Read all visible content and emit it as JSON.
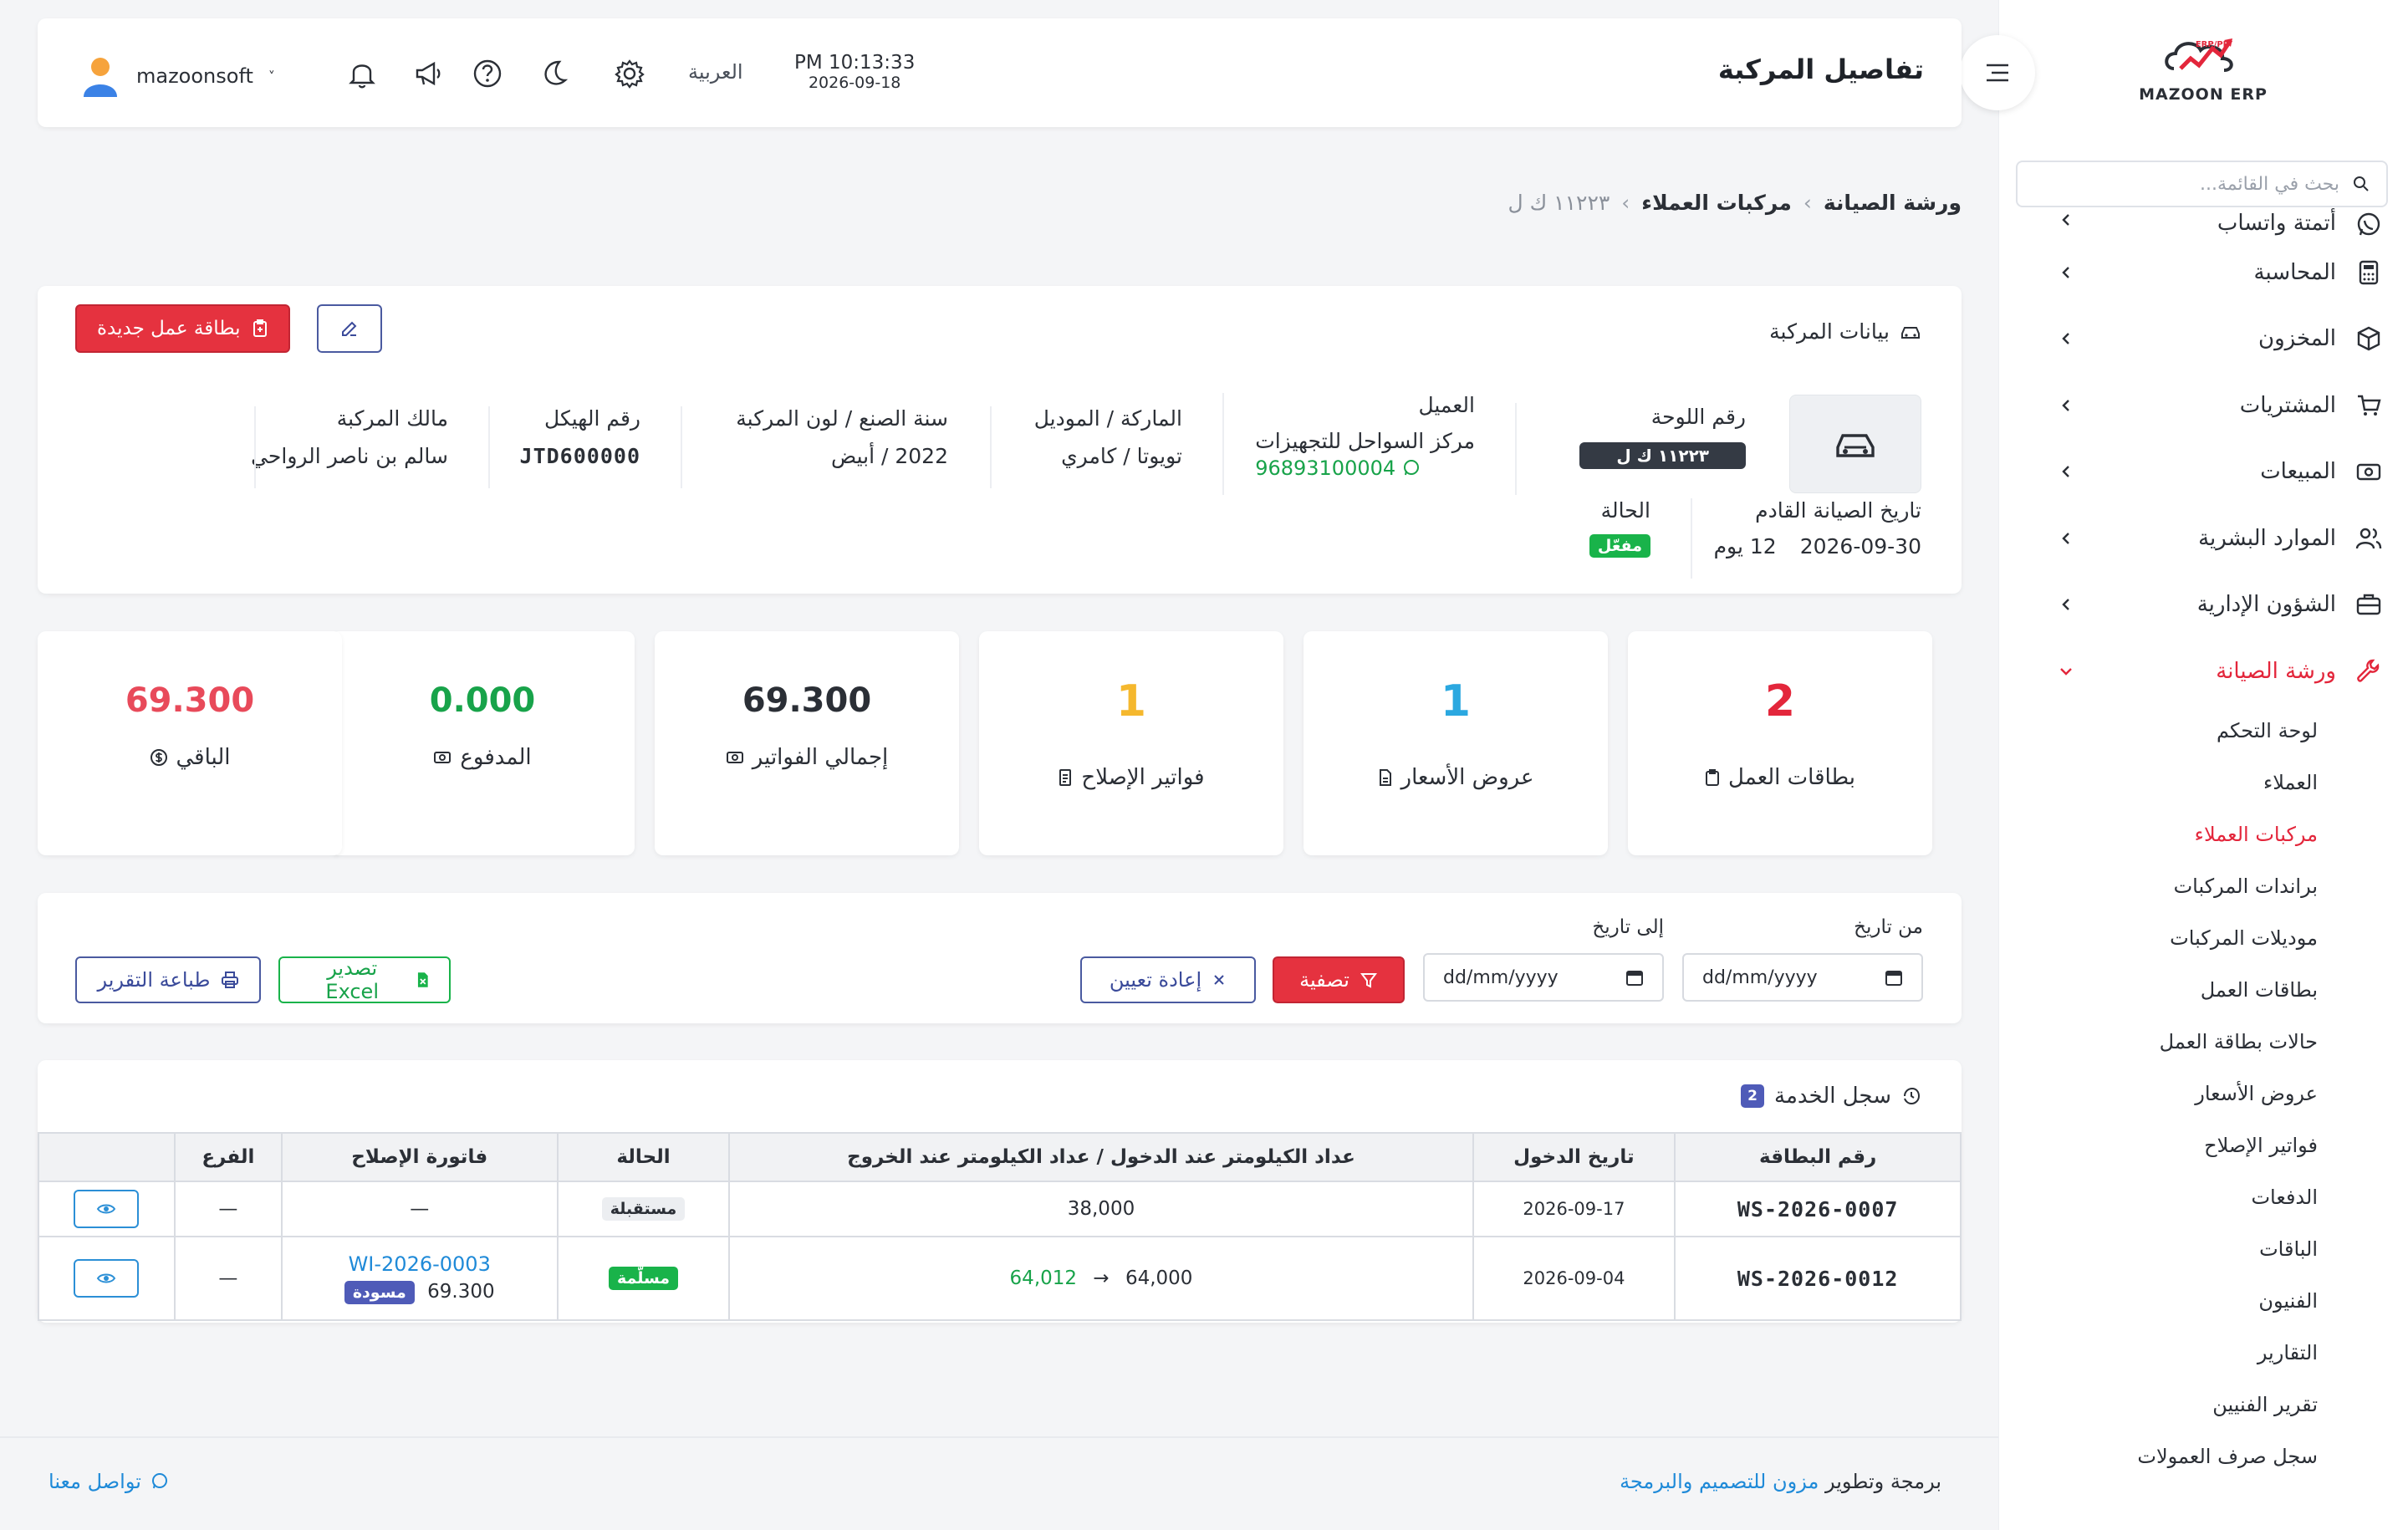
{
  "brand": {
    "name": "MAZOON ERP",
    "tagline": "ERP/PP"
  },
  "sidebar": {
    "search_placeholder": "بحث في القائمة...",
    "items": [
      {
        "label": "أتمتة واتساب",
        "icon": "whatsapp-icon"
      },
      {
        "label": "المحاسبة",
        "icon": "calculator-icon"
      },
      {
        "label": "المخزون",
        "icon": "box-icon"
      },
      {
        "label": "المشتريات",
        "icon": "cart-icon"
      },
      {
        "label": "المبيعات",
        "icon": "cash-icon"
      },
      {
        "label": "الموارد البشرية",
        "icon": "users-icon"
      },
      {
        "label": "الشؤون الإدارية",
        "icon": "briefcase-icon"
      },
      {
        "label": "ورشة الصيانة",
        "icon": "wrench-icon"
      }
    ],
    "subitems": [
      "لوحة التحكم",
      "العملاء",
      "مركبات العملاء",
      "براندات المركبات",
      "موديلات المركبات",
      "بطاقات العمل",
      "حالات بطاقة العمل",
      "عروض الأسعار",
      "فواتير الإصلاح",
      "الدفعات",
      "الباقات",
      "الفنيون",
      "التقارير",
      "تقرير الفنيين",
      "سجل صرف العمولات"
    ]
  },
  "header": {
    "title": "تفاصيل المركبة",
    "time": "PM 10:13:33",
    "date": "2026-09-18",
    "language": "العربية",
    "username": "mazoonsoft"
  },
  "breadcrumb": {
    "first": "ورشة الصيانة",
    "second": "مركبات العملاء",
    "current": "١١٢٢٣ ك ل"
  },
  "vehicle": {
    "section_title": "بيانات المركبة",
    "new_job_card": "بطاقة عمل جديدة",
    "plate_label": "رقم اللوحة",
    "plate_value": "١١٢٢٣ ك ل",
    "customer_label": "العميل",
    "customer_value": "مركز السواحل للتجهيزات",
    "customer_phone": "96893100004",
    "make_label": "الماركة / الموديل",
    "make_value": "تويوتا / كامري",
    "year_label": "سنة الصنع / لون المركبة",
    "year_value": "2022 / أبيض",
    "chassis_label": "رقم الهيكل",
    "chassis_value": "JTD600000",
    "owner_label": "مالك المركبة",
    "owner_value": "سالم بن ناصر الرواحي",
    "next_service_label": "تاريخ الصيانة القادم",
    "next_service_date": "2026-09-30",
    "next_service_days": "12 يوم",
    "status_label": "الحالة",
    "status_value": "مفعّل"
  },
  "stats": [
    {
      "label": "بطاقات العمل",
      "value": "2",
      "color": "#e3263b"
    },
    {
      "label": "عروض الأسعار",
      "value": "1",
      "color": "#2ba8e0"
    },
    {
      "label": "فواتير الإصلاح",
      "value": "1",
      "color": "#f5b82e"
    },
    {
      "label": "إجمالي الفواتير",
      "value": "69.300",
      "color": "#2b2f36"
    },
    {
      "label": "المدفوع",
      "value": "0.000",
      "color": "#18a34a"
    },
    {
      "label": "الباقي",
      "value": "69.300",
      "color": "#e84a5a"
    }
  ],
  "filter": {
    "from_label": "من تاريخ",
    "to_label": "إلى تاريخ",
    "date_placeholder": "dd/mm/yyyy",
    "filter_btn": "تصفية",
    "reset_btn": "إعادة تعيين",
    "excel_btn": "تصدير Excel",
    "print_btn": "طباعة التقرير"
  },
  "service_log": {
    "title": "سجل الخدمة",
    "count": "2",
    "columns": [
      "رقم البطاقة",
      "تاريخ الدخول",
      "عداد الكيلومتر عند الدخول / عداد الكيلومتر عند الخروج",
      "الحالة",
      "فاتورة الإصلاح",
      "الفرع",
      ""
    ],
    "rows": [
      {
        "card": "WS-2026-0007",
        "date": "2026-09-17",
        "km_in": "38,000",
        "km_out": "",
        "status": "مستقبلة",
        "invoice": "—",
        "amount": "",
        "invoice_status": "",
        "branch": "—"
      },
      {
        "card": "WS-2026-0012",
        "date": "2026-09-04",
        "km_in": "64,000",
        "km_out": "64,012",
        "status": "مسلّمة",
        "invoice": "WI-2026-0003",
        "amount": "69.300",
        "invoice_status": "مسودة",
        "branch": "—"
      }
    ]
  },
  "footer": {
    "prefix": "برمجة وتطوير",
    "company": "مزون للتصميم والبرمجة",
    "contact": "تواصل معنا"
  }
}
